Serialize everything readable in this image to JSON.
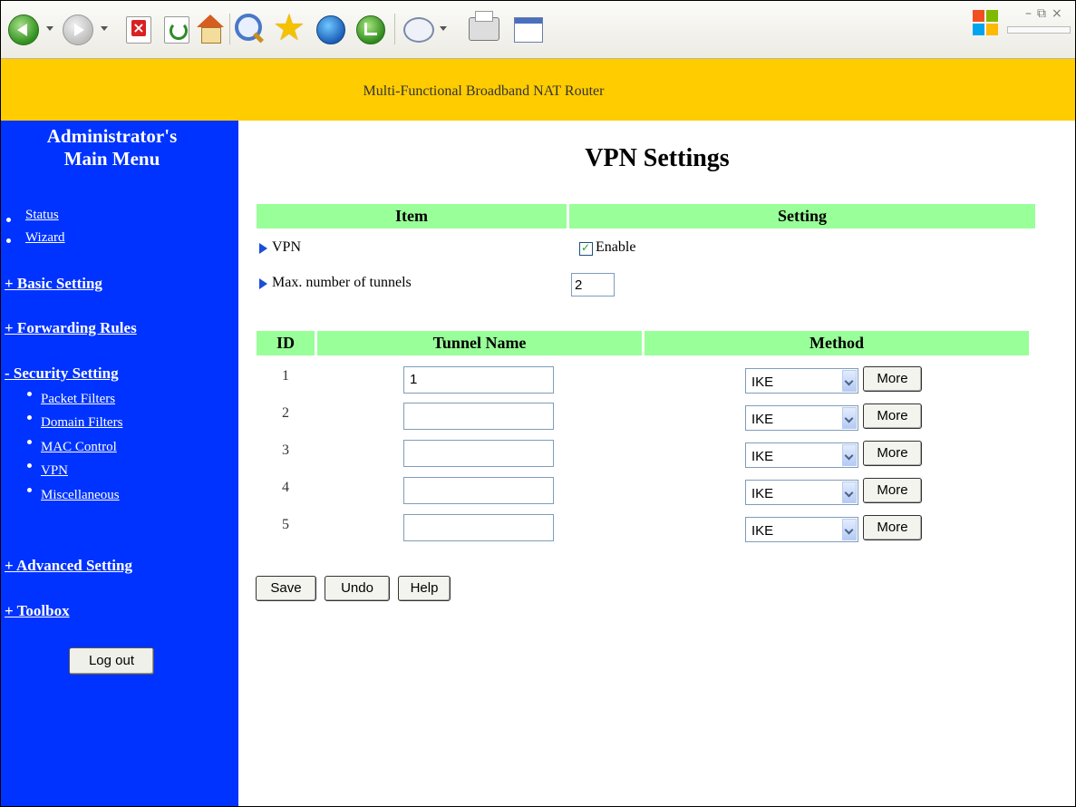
{
  "banner": {
    "title": "Multi-Functional Broadband NAT Router"
  },
  "sidebar": {
    "title_line1": "Administrator's",
    "title_line2": "Main Menu",
    "links": {
      "status": "Status",
      "wizard": "Wizard"
    },
    "sections": {
      "basic": "+ Basic Setting",
      "forwarding": "+ Forwarding Rules",
      "security": "- Security Setting",
      "advanced": "+ Advanced Setting",
      "toolbox": "+ Toolbox"
    },
    "security_items": [
      "Packet Filters",
      "Domain Filters",
      "MAC Control",
      "VPN",
      "Miscellaneous"
    ],
    "logout_label": "Log out"
  },
  "page": {
    "title": "VPN Settings",
    "settings_header": {
      "item": "Item",
      "setting": "Setting"
    },
    "vpn_label": "VPN",
    "enable_label": "Enable",
    "enable_checked": true,
    "max_tunnels_label": "Max. number of tunnels",
    "max_tunnels_value": "2",
    "tunnel_header": {
      "id": "ID",
      "name": "Tunnel Name",
      "method": "Method"
    },
    "tunnels": [
      {
        "id": "1",
        "name": "1",
        "method": "IKE",
        "more": "More"
      },
      {
        "id": "2",
        "name": "",
        "method": "IKE",
        "more": "More"
      },
      {
        "id": "3",
        "name": "",
        "method": "IKE",
        "more": "More"
      },
      {
        "id": "4",
        "name": "",
        "method": "IKE",
        "more": "More"
      },
      {
        "id": "5",
        "name": "",
        "method": "IKE",
        "more": "More"
      }
    ],
    "buttons": {
      "save": "Save",
      "undo": "Undo",
      "help": "Help"
    }
  },
  "colors": {
    "banner": "#ffcc00",
    "sidebar": "#0033ff",
    "table_header": "#99ff99"
  },
  "toolbar_icons": [
    "back-icon",
    "forward-icon",
    "stop-icon",
    "refresh-icon",
    "home-icon",
    "search-icon",
    "favorites-icon",
    "media-icon",
    "history-icon",
    "mail-icon",
    "print-icon",
    "edit-icon",
    "windows-logo-icon"
  ]
}
